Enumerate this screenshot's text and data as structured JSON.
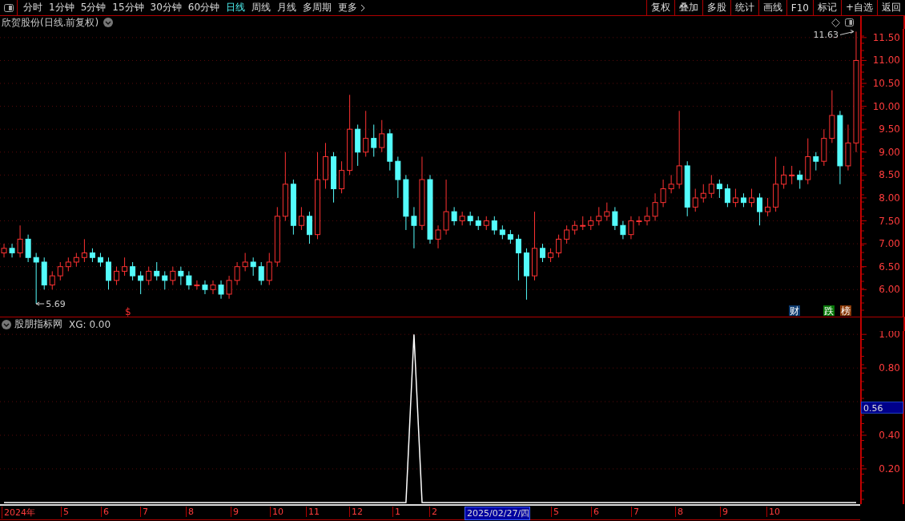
{
  "toolbar": {
    "periods": [
      {
        "label": "分时",
        "selected": false
      },
      {
        "label": "1分钟",
        "selected": false
      },
      {
        "label": "5分钟",
        "selected": false
      },
      {
        "label": "15分钟",
        "selected": false
      },
      {
        "label": "30分钟",
        "selected": false
      },
      {
        "label": "60分钟",
        "selected": false
      },
      {
        "label": "日线",
        "selected": true
      },
      {
        "label": "周线",
        "selected": false
      },
      {
        "label": "月线",
        "selected": false
      },
      {
        "label": "多周期",
        "selected": false
      },
      {
        "label": "更多",
        "selected": false
      }
    ],
    "buttons": [
      "复权",
      "叠加",
      "多股",
      "统计",
      "画线",
      "F10",
      "标记",
      "+自选",
      "返回"
    ]
  },
  "upper_chart": {
    "title": "欣贺股份(日线.前复权)",
    "high_label": "11.63",
    "low_label": "5.69",
    "marker": "$",
    "badges": [
      {
        "label": "财",
        "color": "#0c3a6e"
      },
      {
        "label": "跌",
        "color": "#0a7a0a"
      },
      {
        "label": "榜",
        "color": "#8a3a08"
      }
    ],
    "chart_data": {
      "type": "candlestick",
      "ylim": [
        5.41,
        11.69
      ],
      "grid": true,
      "yticks": [
        {
          "value": 11.5,
          "label": "11.50"
        },
        {
          "value": 11,
          "label": "11.00"
        },
        {
          "value": 10.5,
          "label": "10.50"
        },
        {
          "value": 10,
          "label": "10.00"
        },
        {
          "value": 9.5,
          "label": "9.50"
        },
        {
          "value": 9,
          "label": "9.00"
        },
        {
          "value": 8.5,
          "label": "8.50"
        },
        {
          "value": 8,
          "label": "8.00"
        },
        {
          "value": 7.5,
          "label": "7.50"
        },
        {
          "value": 7,
          "label": "7.00"
        },
        {
          "value": 6.5,
          "label": "6.50"
        },
        {
          "value": 6,
          "label": "6.00"
        }
      ],
      "ohlc": [
        [
          6.8,
          7.0,
          6.7,
          6.9
        ],
        [
          6.9,
          7.0,
          6.7,
          6.8
        ],
        [
          6.8,
          7.4,
          6.7,
          7.1
        ],
        [
          7.1,
          7.2,
          6.6,
          6.7
        ],
        [
          6.7,
          6.8,
          5.69,
          6.6
        ],
        [
          6.6,
          6.7,
          6.0,
          6.1
        ],
        [
          6.1,
          6.4,
          6.0,
          6.3
        ],
        [
          6.3,
          6.6,
          6.2,
          6.5
        ],
        [
          6.5,
          6.7,
          6.4,
          6.6
        ],
        [
          6.6,
          6.8,
          6.5,
          6.7
        ],
        [
          6.7,
          7.1,
          6.6,
          6.8
        ],
        [
          6.8,
          6.9,
          6.6,
          6.7
        ],
        [
          6.7,
          6.8,
          6.5,
          6.6
        ],
        [
          6.6,
          6.7,
          6.0,
          6.2
        ],
        [
          6.2,
          6.5,
          6.1,
          6.4
        ],
        [
          6.4,
          6.7,
          6.3,
          6.5
        ],
        [
          6.5,
          6.6,
          6.2,
          6.3
        ],
        [
          6.3,
          6.4,
          5.9,
          6.2
        ],
        [
          6.2,
          6.5,
          6.1,
          6.4
        ],
        [
          6.4,
          6.6,
          6.2,
          6.3
        ],
        [
          6.3,
          6.4,
          6.0,
          6.2
        ],
        [
          6.2,
          6.5,
          6.1,
          6.4
        ],
        [
          6.4,
          6.5,
          6.1,
          6.3
        ],
        [
          6.3,
          6.4,
          6.0,
          6.1
        ],
        [
          6.1,
          6.2,
          6.0,
          6.1
        ],
        [
          6.1,
          6.2,
          5.9,
          6.0
        ],
        [
          6.0,
          6.2,
          5.9,
          6.1
        ],
        [
          6.1,
          6.2,
          5.8,
          5.9
        ],
        [
          5.9,
          6.3,
          5.8,
          6.2
        ],
        [
          6.2,
          6.6,
          6.1,
          6.5
        ],
        [
          6.5,
          6.8,
          6.4,
          6.6
        ],
        [
          6.6,
          6.7,
          6.3,
          6.5
        ],
        [
          6.5,
          6.6,
          6.1,
          6.2
        ],
        [
          6.2,
          6.8,
          6.1,
          6.6
        ],
        [
          6.6,
          7.8,
          6.5,
          7.6
        ],
        [
          7.6,
          9.0,
          7.5,
          8.3
        ],
        [
          8.3,
          8.4,
          7.2,
          7.4
        ],
        [
          7.4,
          7.8,
          7.3,
          7.6
        ],
        [
          7.6,
          7.7,
          7.0,
          7.2
        ],
        [
          7.2,
          9.0,
          7.1,
          8.4
        ],
        [
          8.4,
          9.2,
          8.2,
          8.9
        ],
        [
          8.9,
          9.0,
          7.9,
          8.2
        ],
        [
          8.2,
          8.8,
          8.1,
          8.6
        ],
        [
          8.6,
          10.25,
          8.5,
          9.5
        ],
        [
          9.5,
          9.6,
          8.7,
          9.0
        ],
        [
          9.0,
          9.9,
          8.9,
          9.3
        ],
        [
          9.3,
          9.6,
          8.9,
          9.1
        ],
        [
          9.1,
          9.7,
          9.0,
          9.4
        ],
        [
          9.4,
          9.5,
          8.6,
          8.8
        ],
        [
          8.8,
          8.9,
          8.0,
          8.4
        ],
        [
          8.4,
          8.5,
          7.3,
          7.6
        ],
        [
          7.6,
          7.8,
          6.9,
          7.4
        ],
        [
          7.4,
          8.9,
          7.3,
          8.4
        ],
        [
          8.4,
          8.5,
          7.0,
          7.1
        ],
        [
          7.1,
          7.4,
          6.9,
          7.3
        ],
        [
          7.3,
          8.4,
          7.2,
          7.7
        ],
        [
          7.7,
          7.8,
          7.4,
          7.5
        ],
        [
          7.5,
          7.7,
          7.4,
          7.6
        ],
        [
          7.6,
          7.7,
          7.4,
          7.5
        ],
        [
          7.5,
          7.6,
          7.3,
          7.4
        ],
        [
          7.4,
          7.6,
          7.3,
          7.5
        ],
        [
          7.5,
          7.6,
          7.2,
          7.3
        ],
        [
          7.3,
          7.4,
          7.1,
          7.2
        ],
        [
          7.2,
          7.3,
          7.0,
          7.1
        ],
        [
          7.1,
          7.2,
          6.2,
          6.8
        ],
        [
          6.8,
          6.9,
          5.78,
          6.3
        ],
        [
          6.3,
          7.7,
          6.2,
          6.9
        ],
        [
          6.9,
          7.0,
          6.6,
          6.7
        ],
        [
          6.7,
          6.9,
          6.6,
          6.8
        ],
        [
          6.8,
          7.2,
          6.7,
          7.1
        ],
        [
          7.1,
          7.4,
          7.0,
          7.3
        ],
        [
          7.3,
          7.5,
          7.2,
          7.4
        ],
        [
          7.4,
          7.6,
          7.3,
          7.4
        ],
        [
          7.4,
          7.6,
          7.3,
          7.5
        ],
        [
          7.5,
          7.8,
          7.4,
          7.6
        ],
        [
          7.6,
          7.9,
          7.5,
          7.7
        ],
        [
          7.7,
          7.8,
          7.3,
          7.4
        ],
        [
          7.4,
          7.5,
          7.1,
          7.2
        ],
        [
          7.2,
          7.6,
          7.1,
          7.5
        ],
        [
          7.5,
          7.6,
          7.4,
          7.5
        ],
        [
          7.5,
          7.8,
          7.4,
          7.6
        ],
        [
          7.6,
          8.1,
          7.5,
          7.9
        ],
        [
          7.9,
          8.4,
          7.8,
          8.2
        ],
        [
          8.2,
          8.5,
          8.1,
          8.3
        ],
        [
          8.3,
          9.9,
          8.2,
          8.7
        ],
        [
          8.7,
          8.8,
          7.6,
          7.8
        ],
        [
          7.8,
          8.2,
          7.7,
          8.0
        ],
        [
          8.0,
          8.3,
          7.9,
          8.1
        ],
        [
          8.1,
          8.5,
          8.0,
          8.3
        ],
        [
          8.3,
          8.4,
          8.0,
          8.2
        ],
        [
          8.2,
          8.3,
          7.8,
          7.9
        ],
        [
          7.9,
          8.2,
          7.8,
          8.0
        ],
        [
          8.0,
          8.1,
          7.8,
          7.9
        ],
        [
          7.9,
          8.2,
          7.8,
          8.0
        ],
        [
          8.0,
          8.1,
          7.4,
          7.7
        ],
        [
          7.7,
          8.0,
          7.6,
          7.8
        ],
        [
          7.8,
          8.9,
          7.7,
          8.3
        ],
        [
          8.3,
          8.7,
          8.2,
          8.5
        ],
        [
          8.5,
          8.7,
          8.3,
          8.5
        ],
        [
          8.5,
          8.6,
          8.2,
          8.4
        ],
        [
          8.4,
          9.3,
          8.3,
          8.9
        ],
        [
          8.9,
          9.0,
          8.6,
          8.8
        ],
        [
          8.8,
          9.5,
          8.7,
          9.3
        ],
        [
          9.3,
          10.35,
          9.2,
          9.8
        ],
        [
          9.8,
          9.9,
          8.3,
          8.7
        ],
        [
          8.7,
          9.6,
          8.6,
          9.2
        ],
        [
          9.2,
          11.63,
          9.0,
          11.0
        ]
      ]
    }
  },
  "lower_chart": {
    "title": "股朋指标网",
    "reading": "XG: 0.00",
    "cursor_value": "0.56",
    "chart_data": {
      "type": "line",
      "ylim": [
        -0.01,
        1.02
      ],
      "grid": true,
      "yticks": [
        {
          "value": 1,
          "label": "1.00"
        },
        {
          "value": 0.8,
          "label": "0.80"
        },
        {
          "value": 0.4,
          "label": "0.40"
        },
        {
          "value": 0.2,
          "label": "0.20"
        }
      ],
      "values": [
        0,
        0,
        0,
        0,
        0,
        0,
        0,
        0,
        0,
        0,
        0,
        0,
        0,
        0,
        0,
        0,
        0,
        0,
        0,
        0,
        0,
        0,
        0,
        0,
        0,
        0,
        0,
        0,
        0,
        0,
        0,
        0,
        0,
        0,
        0,
        0,
        0,
        0,
        0,
        0,
        0,
        0,
        0,
        0,
        0,
        0,
        0,
        0,
        0,
        0,
        0,
        1,
        0,
        0,
        0,
        0,
        0,
        0,
        0,
        0,
        0,
        0,
        0,
        0,
        0,
        0,
        0,
        0,
        0,
        0,
        0,
        0,
        0,
        0,
        0,
        0,
        0,
        0,
        0,
        0,
        0,
        0,
        0,
        0,
        0,
        0,
        0,
        0,
        0,
        0,
        0,
        0,
        0,
        0,
        0,
        0,
        0,
        0,
        0,
        0,
        0,
        0,
        0,
        0,
        0,
        0,
        0
      ]
    }
  },
  "time_axis": [
    {
      "label": "2024年",
      "selected": false
    },
    {
      "label": "5",
      "selected": false
    },
    {
      "label": "6",
      "selected": false
    },
    {
      "label": "7",
      "selected": false
    },
    {
      "label": "8",
      "selected": false
    },
    {
      "label": "9",
      "selected": false
    },
    {
      "label": "10",
      "selected": false
    },
    {
      "label": "11",
      "selected": false
    },
    {
      "label": "12",
      "selected": false
    },
    {
      "label": "1",
      "selected": false
    },
    {
      "label": "2",
      "selected": false
    },
    {
      "label": "2025/02/27/四",
      "selected": true
    },
    {
      "label": "5",
      "selected": false
    },
    {
      "label": "6",
      "selected": false
    },
    {
      "label": "7",
      "selected": false
    },
    {
      "label": "8",
      "selected": false
    },
    {
      "label": "9",
      "selected": false
    },
    {
      "label": "10",
      "selected": false
    }
  ]
}
